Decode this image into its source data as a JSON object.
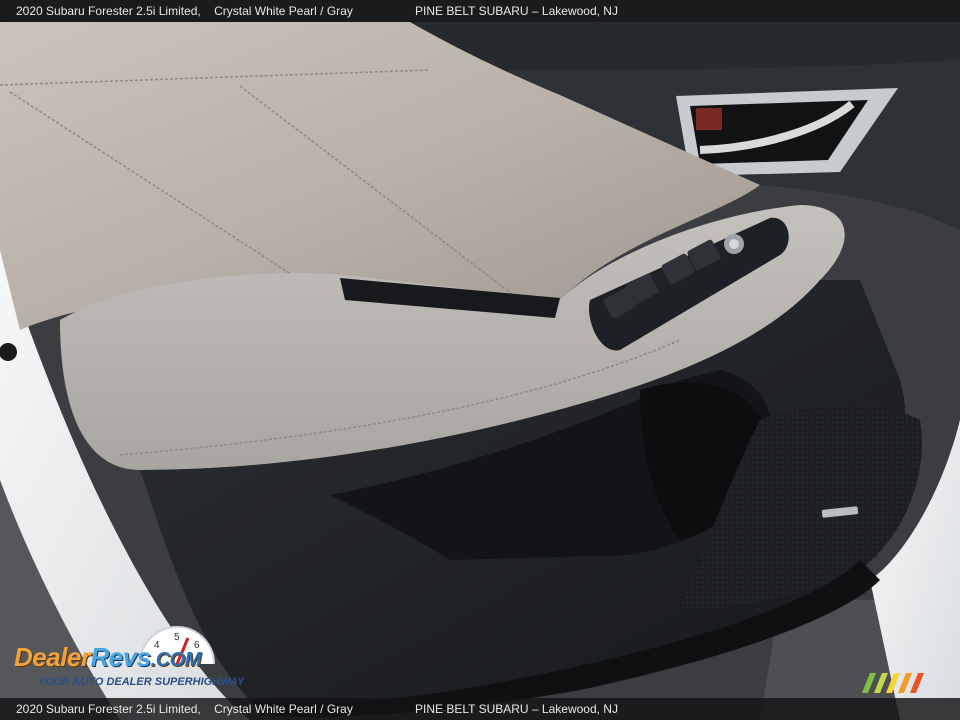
{
  "caption": {
    "vehicle": "2020 Subaru Forester 2.5i Limited,",
    "color": "Crystal White Pearl / Gray",
    "dealer": "PINE BELT SUBARU – Lakewood, NJ"
  },
  "watermark": {
    "brand_dealer": "Dealer",
    "brand_revs": "Revs",
    "brand_com": ".COM",
    "tagline": "YOUR AUTO DEALER SUPERHIGHWAY",
    "gauge_digits": [
      "4",
      "5",
      "6"
    ]
  },
  "colors": {
    "leather_gray": "#b7b2ab",
    "trim_black": "#1f2226",
    "door_white": "#eef0f2",
    "asphalt": "#55575a",
    "brand_orange": "#f2a23a",
    "brand_blue": "#4aa6e0"
  }
}
